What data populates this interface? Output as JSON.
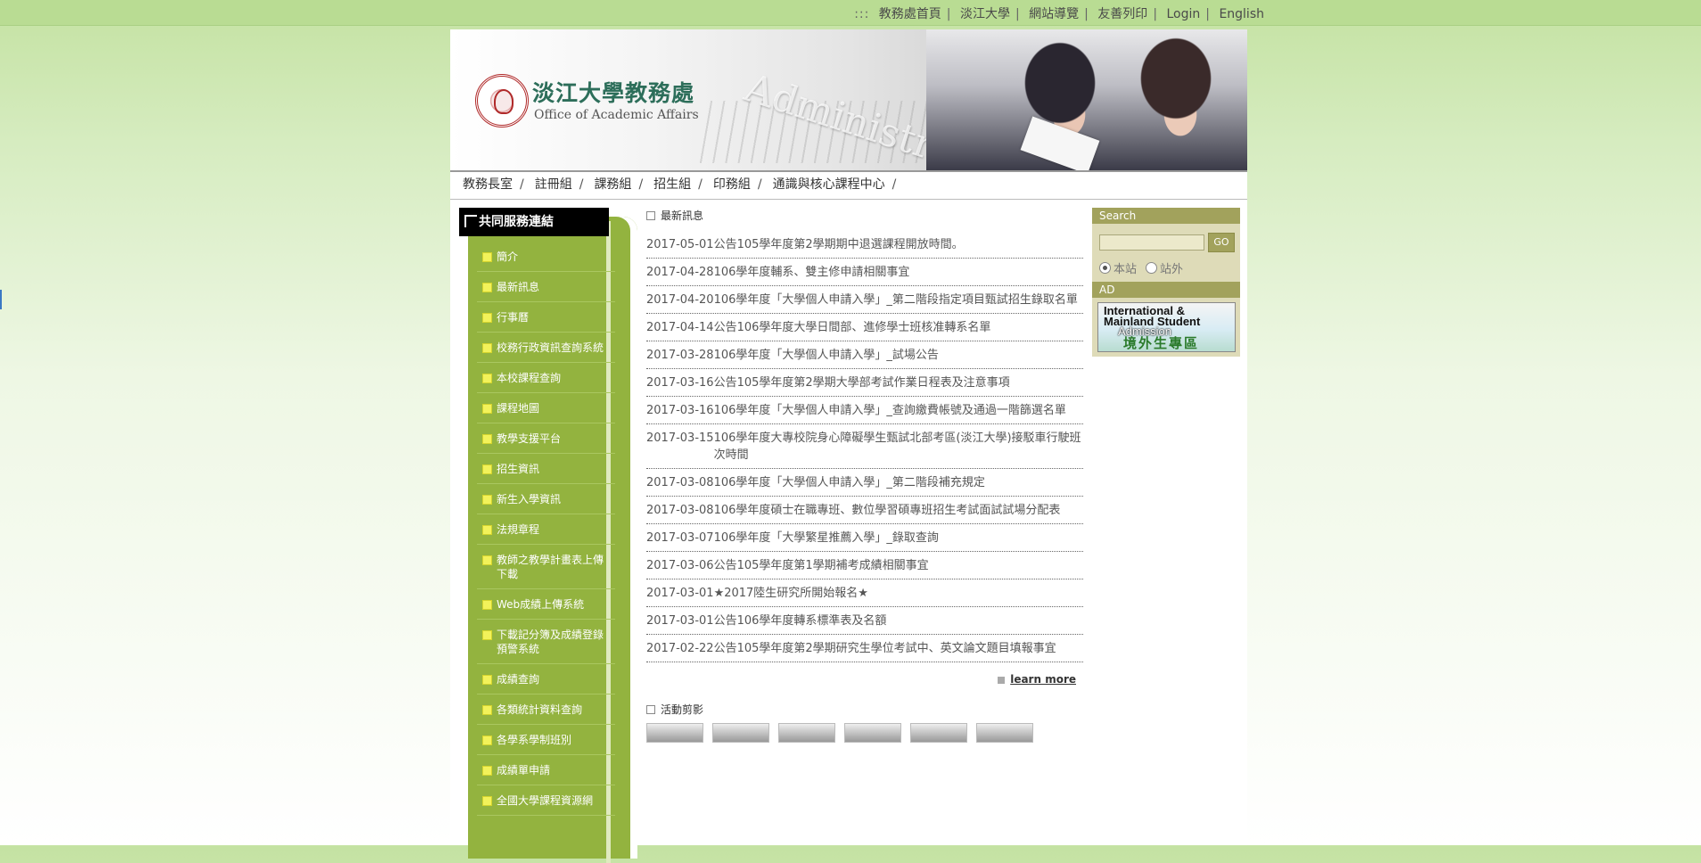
{
  "toplinks": {
    "prefix": ":::",
    "items": [
      "教務處首頁",
      "淡江大學",
      "網站導覽",
      "友善列印",
      "Login",
      "English"
    ]
  },
  "banner": {
    "title_cn": "淡江大學教務處",
    "title_en": "Office of Academic Affairs",
    "watermark": "Administration B"
  },
  "mainnav": [
    "教務長室",
    "註冊組",
    "課務組",
    "招生組",
    "印務組",
    "通識與核心課程中心"
  ],
  "sidebar": {
    "title": "共同服務連結",
    "items": [
      "簡介",
      "最新訊息",
      "行事曆",
      "校務行政資訊查詢系統",
      "本校課程查詢",
      "課程地圖",
      "教學支援平台",
      "招生資訊",
      "新生入學資訊",
      "法規章程",
      "教師之教學計畫表上傳下載",
      "Web成績上傳系統",
      "下載記分簿及成績登錄預警系統",
      "成績查詢",
      "各類統計資料查詢",
      "各學系學制班別",
      "成績單申請",
      "全國大學課程資源網"
    ]
  },
  "news": {
    "heading": "最新訊息",
    "items": [
      {
        "date": "2017-05-01",
        "title": "公告105學年度第2學期期中退選課程開放時間。"
      },
      {
        "date": "2017-04-28",
        "title": "106學年度輔系、雙主修申請相關事宜"
      },
      {
        "date": "2017-04-20",
        "title": "106學年度「大學個人申請入學」_第二階段指定項目甄試招生錄取名單"
      },
      {
        "date": "2017-04-14",
        "title": "公告106學年度大學日間部、進修學士班核准轉系名單"
      },
      {
        "date": "2017-03-28",
        "title": "106學年度「大學個人申請入學」_試場公告"
      },
      {
        "date": "2017-03-16",
        "title": "公告105學年度第2學期大學部考試作業日程表及注意事項"
      },
      {
        "date": "2017-03-16",
        "title": "106學年度「大學個人申請入學」_查詢繳費帳號及通過一階篩選名單"
      },
      {
        "date": "2017-03-15",
        "title": "106學年度大專校院身心障礙學生甄試北部考區(淡江大學)接駁車行駛班次時間"
      },
      {
        "date": "2017-03-08",
        "title": "106學年度「大學個人申請入學」_第二階段補充規定"
      },
      {
        "date": "2017-03-08",
        "title": "106學年度碩士在職專班、數位學習碩專班招生考試面試試場分配表"
      },
      {
        "date": "2017-03-07",
        "title": "106學年度「大學繁星推薦入學」_錄取查詢"
      },
      {
        "date": "2017-03-06",
        "title": "公告105學年度第1學期補考成績相關事宜"
      },
      {
        "date": "2017-03-01",
        "title": "★2017陸生研究所開始報名★"
      },
      {
        "date": "2017-03-01",
        "title": "公告106學年度轉系標準表及名額"
      },
      {
        "date": "2017-02-22",
        "title": "公告105學年度第2學期研究生學位考試中、英文論文題目填報事宜"
      }
    ],
    "learn_more": "learn more"
  },
  "photos": {
    "heading": "活動剪影"
  },
  "search": {
    "heading": "Search",
    "go_label": "GO",
    "option_site": "本站",
    "option_external": "站外",
    "selected": "本站"
  },
  "ad": {
    "heading": "AD",
    "line1": "International  &",
    "line2": "Mainland Student",
    "line3": "Admission",
    "line4": "境外生專區"
  },
  "colors": {
    "topbar": "#b9dc93",
    "sidebar": "#93b33f",
    "right_header": "#a2a25c",
    "right_box": "#dedbb8"
  }
}
